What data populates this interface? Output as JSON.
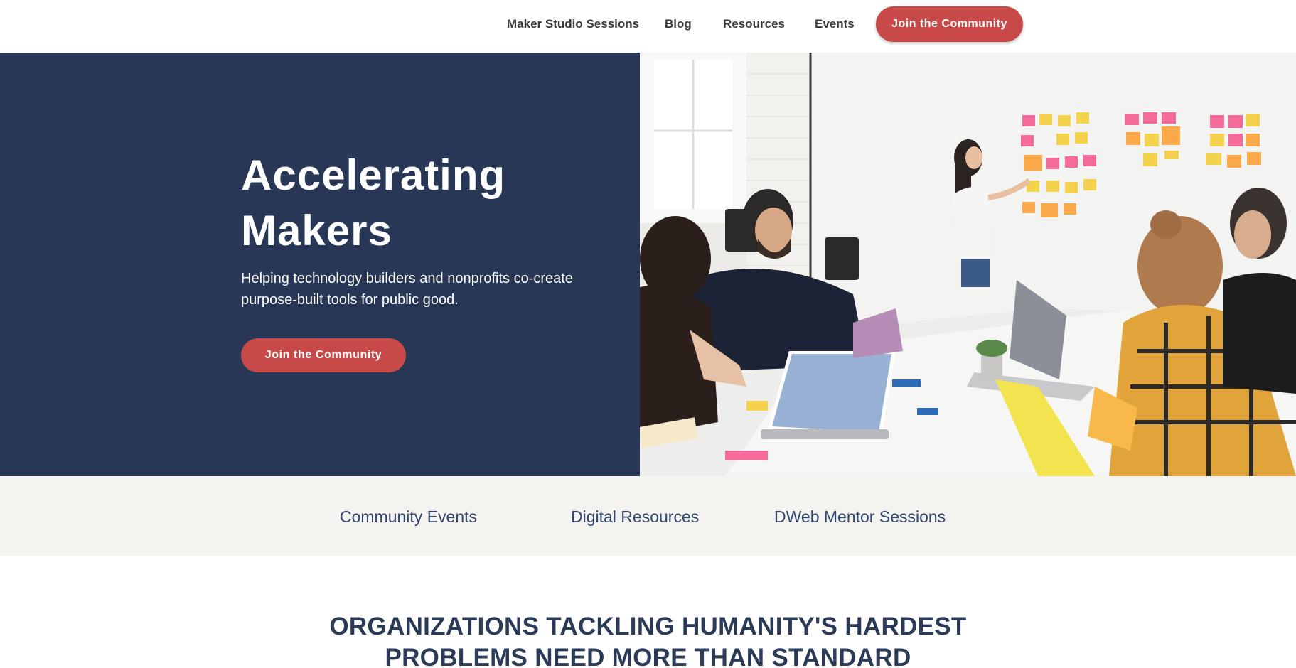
{
  "nav": {
    "links": [
      "Maker Studio Sessions",
      "Blog",
      "Resources",
      "Events"
    ],
    "cta_label": "Join the Community"
  },
  "hero": {
    "title_line1": "Accelerating",
    "title_line2": "Makers",
    "subtitle_line1": "Helping technology builders and nonprofits co-create",
    "subtitle_line2": "purpose-built tools for public good.",
    "cta_label": "Join the Community",
    "photo_alt": "team-meeting-photo"
  },
  "quicklinks": {
    "items": [
      "Community Events",
      "Digital Resources",
      "DWeb Mentor Sessions"
    ]
  },
  "statement": {
    "line1": "ORGANIZATIONS TACKLING HUMANITY'S HARDEST",
    "line2": "PROBLEMS NEED MORE THAN STANDARD"
  },
  "colors": {
    "navy": "#283755",
    "brand_red": "#c84a48",
    "band_bg": "#f5f3f0",
    "link_blue": "#2f4570"
  }
}
